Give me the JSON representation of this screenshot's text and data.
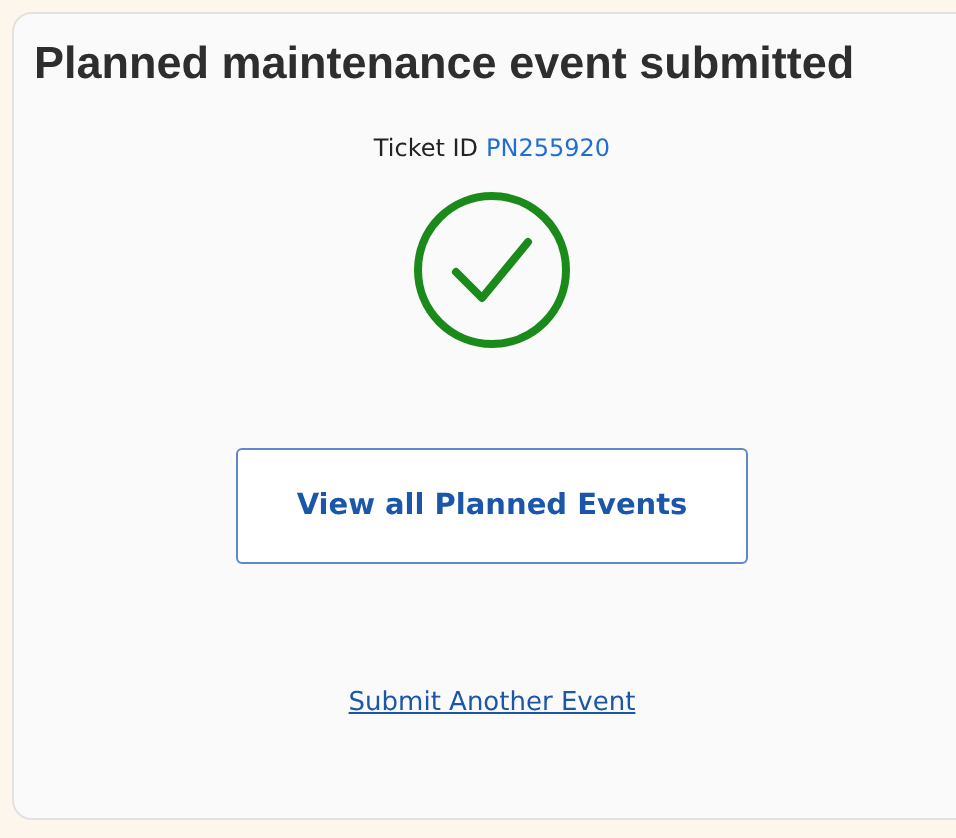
{
  "card": {
    "title": "Planned maintenance event submitted",
    "ticket": {
      "label": "Ticket ID",
      "id": "PN255920"
    },
    "status": {
      "kind": "success"
    },
    "primary_button": "View all Planned Events",
    "link": "Submit Another Event"
  }
}
